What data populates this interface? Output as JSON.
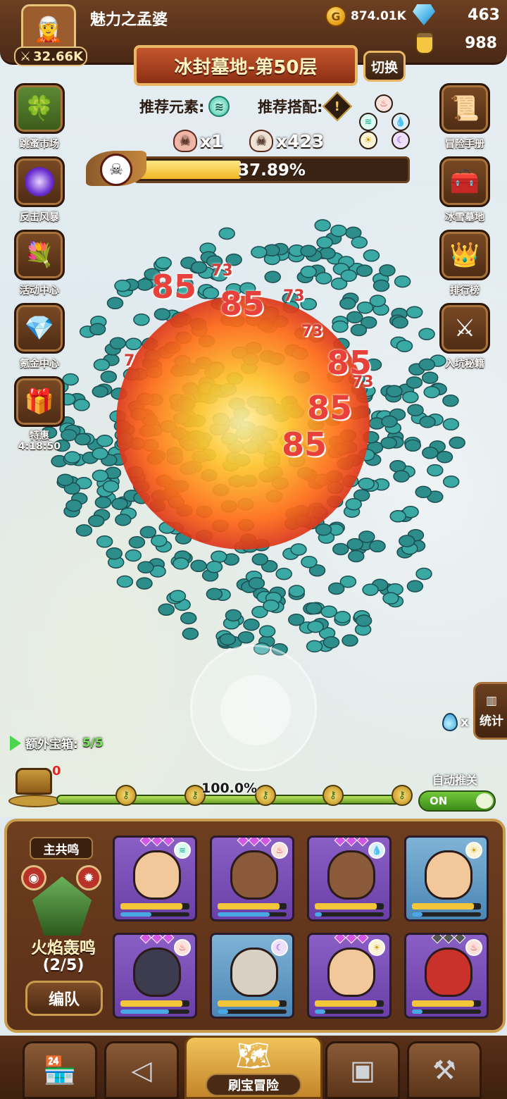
{
  "header": {
    "player_name": "魅力之孟婆",
    "power": "32.66K",
    "coins": "874.01K",
    "gems": "463",
    "potions": "988"
  },
  "stage": {
    "title": "冰封墓地-第50层",
    "switch_label": "切换",
    "recommended_element_label": "推荐元素:",
    "recommended_combo_label": "推荐搭配:",
    "boss_kills": "x1",
    "minion_kills": "x423",
    "boss_progress_text": "37.89%",
    "boss_progress_value": 0.3789
  },
  "side_left": [
    {
      "label": "跳蚤市场",
      "icon": "clover-icon"
    },
    {
      "label": "反击风暴",
      "icon": "vortex-icon"
    },
    {
      "label": "活动中心",
      "icon": "flower-bouquet-icon"
    },
    {
      "label": "氪金中心",
      "icon": "diamond-icon"
    },
    {
      "label": "特惠",
      "icon": "gift-chest-icon",
      "timer": "4:18:50"
    }
  ],
  "side_right": [
    {
      "label": "冒险手册",
      "icon": "scroll-icon"
    },
    {
      "label": "冰雪墓地",
      "icon": "treasure-chest-icon"
    },
    {
      "label": "排行榜",
      "icon": "crown-icon"
    },
    {
      "label": "入坑秘籍",
      "icon": "crossed-swords-icon"
    }
  ],
  "damage_numbers": [
    "85",
    "85",
    "85",
    "85",
    "85",
    "73",
    "73",
    "73",
    "73",
    "7"
  ],
  "stats": {
    "label": "统计",
    "drop_text": "x"
  },
  "route": {
    "extra_chest_label": "额外宝箱:",
    "extra_chest_count": "5/5",
    "chest_count": "0",
    "progress_text": "100.0%",
    "progress_value": 1.0,
    "auto_label": "自动推关",
    "toggle_state": "ON"
  },
  "team": {
    "resonance_tag": "主共鸣",
    "resonance_name": "火焰轰鸣",
    "resonance_count": "(2/5)",
    "formation_label": "编队",
    "heroes": [
      {
        "name": "hero-elf-girl",
        "rarity": "purple",
        "element": "wind",
        "hp": 0.9,
        "mp": 0.45
      },
      {
        "name": "hero-fire-monkey",
        "rarity": "purple",
        "element": "fire",
        "hp": 0.9,
        "mp": 0.75
      },
      {
        "name": "hero-bald-warrior",
        "rarity": "purple",
        "element": "water",
        "hp": 0.9,
        "mp": 0.1
      },
      {
        "name": "hero-masked-rogue",
        "rarity": "blue",
        "element": "light",
        "hp": 0.9,
        "mp": 0.15
      },
      {
        "name": "hero-hooded-skull",
        "rarity": "purple",
        "element": "fire",
        "hp": 0.9,
        "mp": 0.7
      },
      {
        "name": "hero-reaper",
        "rarity": "blue",
        "element": "dark",
        "hp": 0.9,
        "mp": 0.15
      },
      {
        "name": "hero-king",
        "rarity": "purple",
        "element": "light",
        "hp": 0.9,
        "mp": 0.15
      },
      {
        "name": "hero-red-demon",
        "rarity": "purple",
        "element": "fire",
        "hp": 0.9,
        "mp": 0.15
      }
    ]
  },
  "bottom_nav": {
    "main_label": "刷宝冒险",
    "items": [
      "shop-icon",
      "hero-icon",
      "map-icon",
      "inventory-icon",
      "forge-icon"
    ]
  },
  "colors": {
    "wood_dark": "#4a2916",
    "wood_trim": "#e9b763",
    "boss_bar_fill": "#f1b726",
    "route_bar_fill": "#b9e25a",
    "toggle_on": "#71c83a",
    "damage_red": "#e8413b"
  }
}
